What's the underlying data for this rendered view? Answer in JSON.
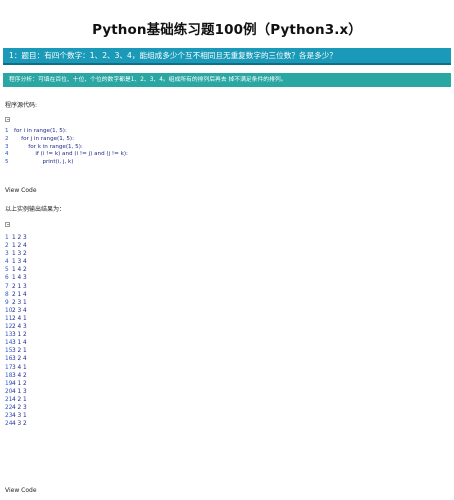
{
  "title": "Python基础练习题100例（Python3.x）",
  "question": "1：题目：有四个数字：1、2、3、4，能组成多少个互不相同且无重复数字的三位数？各是多少？",
  "analysis": "程序分析：可填在百位、十位、个位的数字都是1、2、3、4。组成所有的排列后再去 掉不满足条件的排列。",
  "source_label": "程序源代码:",
  "code_lines": [
    {
      "no": "1",
      "text": "for i in range(1, 5):"
    },
    {
      "no": "2",
      "text": "    for j in range(1, 5):"
    },
    {
      "no": "3",
      "text": "        for k in range(1, 5):"
    },
    {
      "no": "4",
      "text": "            if (i != k) and (i != j) and (j != k):"
    },
    {
      "no": "5",
      "text": "                print(i, j, k)"
    }
  ],
  "view_code_1": "View Code",
  "output_label": "以上实例输出结果为：",
  "output_lines": [
    {
      "no": "1",
      "text": "1 2 3"
    },
    {
      "no": "2",
      "text": "1 2 4"
    },
    {
      "no": "3",
      "text": "1 3 2"
    },
    {
      "no": "4",
      "text": "1 3 4"
    },
    {
      "no": "5",
      "text": "1 4 2"
    },
    {
      "no": "6",
      "text": "1 4 3"
    },
    {
      "no": "7",
      "text": "2 1 3"
    },
    {
      "no": "8",
      "text": "2 1 4"
    },
    {
      "no": "9",
      "text": "2 3 1"
    },
    {
      "no": "10",
      "text": "2 3 4"
    },
    {
      "no": "11",
      "text": "2 4 1"
    },
    {
      "no": "12",
      "text": "2 4 3"
    },
    {
      "no": "13",
      "text": "3 1 2"
    },
    {
      "no": "14",
      "text": "3 1 4"
    },
    {
      "no": "15",
      "text": "3 2 1"
    },
    {
      "no": "16",
      "text": "3 2 4"
    },
    {
      "no": "17",
      "text": "3 4 1"
    },
    {
      "no": "18",
      "text": "3 4 2"
    },
    {
      "no": "19",
      "text": "4 1 2"
    },
    {
      "no": "20",
      "text": "4 1 3"
    },
    {
      "no": "21",
      "text": "4 2 1"
    },
    {
      "no": "22",
      "text": "4 2 3"
    },
    {
      "no": "23",
      "text": "4 3 1"
    },
    {
      "no": "24",
      "text": "4 3 2"
    }
  ],
  "view_code_2": "View Code",
  "icons": {
    "copy": "copy-icon"
  },
  "colors": {
    "question_bar": "#1a9ab8",
    "analysis_bar": "#2aa7a3",
    "code_text": "#1d2a8a"
  }
}
